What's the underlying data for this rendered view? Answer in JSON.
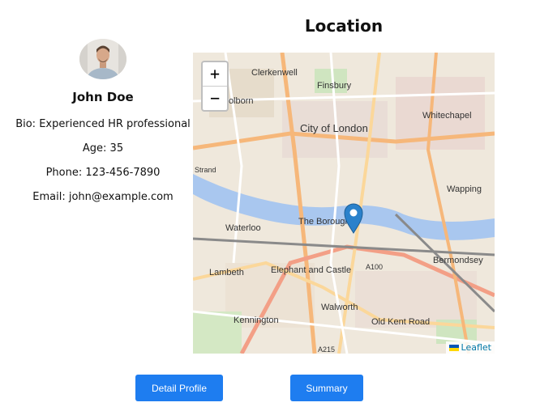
{
  "profile": {
    "name": "John Doe",
    "bio": "Bio: Experienced HR professional",
    "age": "Age: 35",
    "phone": "Phone: 123-456-7890",
    "email": "Email: john@example.com"
  },
  "location": {
    "title": "Location",
    "zoom_in": "+",
    "zoom_out": "−",
    "attribution": "Leaflet",
    "labels": [
      "Clerkenwell",
      "Finsbury",
      "Holborn",
      "City of London",
      "Whitechapel",
      "Strand",
      "Wapping",
      "Waterloo",
      "The Borough",
      "Bermondsey",
      "Elephant and Castle",
      "A100",
      "Lambeth",
      "Walworth",
      "Kennington",
      "Old Kent Road",
      "A215"
    ]
  },
  "buttons": {
    "detail": "Detail Profile",
    "summary": "Summary"
  },
  "colors": {
    "button": "#1e7df0",
    "marker": "#2a81cb",
    "river": "#a9c7ef"
  }
}
